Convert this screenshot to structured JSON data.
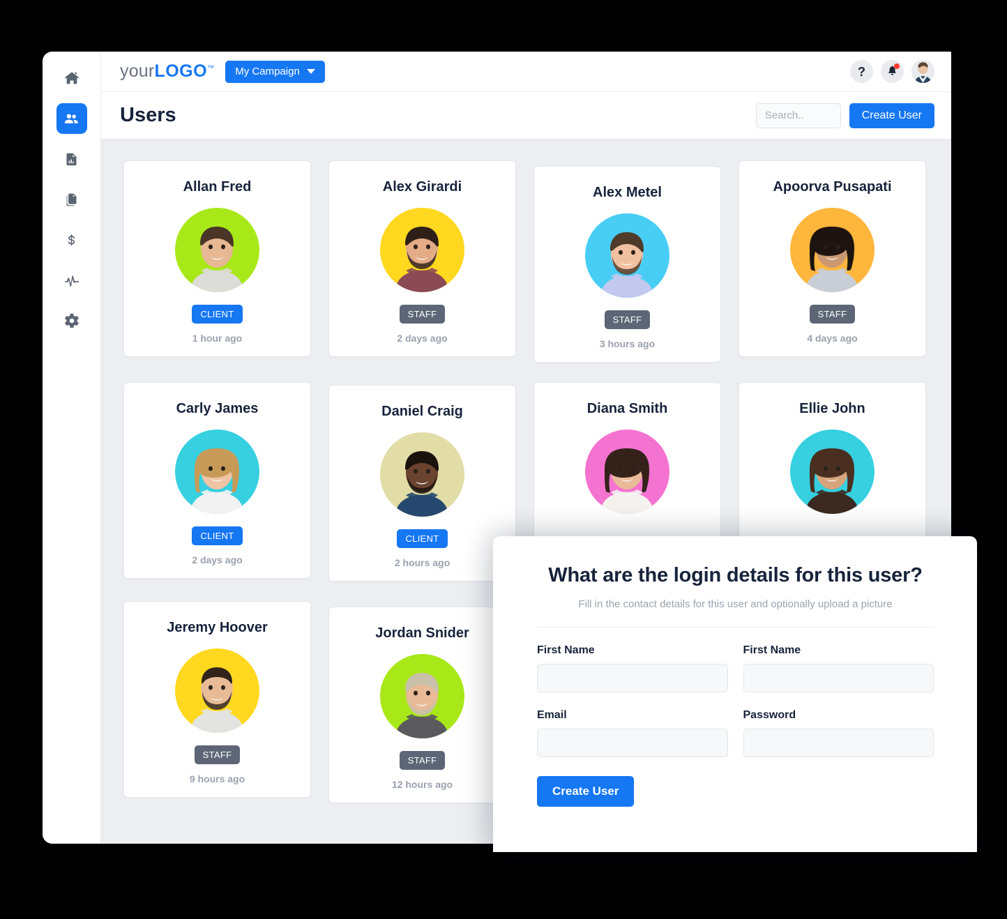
{
  "sidebar": {
    "items": [
      {
        "icon": "home-icon",
        "name": "home",
        "active": false
      },
      {
        "icon": "users-icon",
        "name": "users",
        "active": true
      },
      {
        "icon": "report-icon",
        "name": "reports",
        "active": false
      },
      {
        "icon": "copy-icon",
        "name": "files",
        "active": false
      },
      {
        "icon": "dollar-icon",
        "name": "billing",
        "active": false
      },
      {
        "icon": "activity-icon",
        "name": "activity",
        "active": false
      },
      {
        "icon": "gear-icon",
        "name": "settings",
        "active": false
      }
    ]
  },
  "topbar": {
    "logo_prefix": "your",
    "logo_bold": "LOGO",
    "logo_tm": "™",
    "campaign_label": "My Campaign",
    "help_glyph": "?",
    "icons": [
      "help-icon",
      "notifications-bell-icon",
      "user-avatar"
    ]
  },
  "page_header": {
    "title": "Users",
    "search_placeholder": "Search..",
    "search_value": "",
    "create_user_label": "Create User"
  },
  "users": [
    {
      "name": "Allan Fred",
      "badge": "CLIENT",
      "badge_type": "client",
      "time": "1 hour ago",
      "bg": "#a8e818",
      "photo": "male-smiling",
      "offset": 0
    },
    {
      "name": "Alex Girardi",
      "badge": "STAFF",
      "badge_type": "staff",
      "time": "2 days ago",
      "bg": "#ffd81f",
      "photo": "male-beard",
      "offset": 0
    },
    {
      "name": "Alex Metel",
      "badge": "STAFF",
      "badge_type": "staff",
      "time": "3 hours ago",
      "bg": "#48cdf5",
      "photo": "male-short-hair",
      "offset": 1
    },
    {
      "name": "Apoorva Pusapati",
      "badge": "STAFF",
      "badge_type": "staff",
      "time": "4 days ago",
      "bg": "#ffb63c",
      "photo": "female-long-dark",
      "offset": 0
    },
    {
      "name": "Carly James",
      "badge": "CLIENT",
      "badge_type": "client",
      "time": "2 days ago",
      "bg": "#36d0e0",
      "photo": "female-blonde",
      "offset": 0
    },
    {
      "name": "Daniel Craig",
      "badge": "CLIENT",
      "badge_type": "client",
      "time": "2 hours ago",
      "bg": "#e2dda6",
      "photo": "male-dark-skin",
      "offset": 2
    },
    {
      "name": "Diana Smith",
      "badge": "",
      "badge_type": "",
      "time": "",
      "bg": "#f472d0",
      "photo": "female-brunette",
      "offset": 0
    },
    {
      "name": "Ellie John",
      "badge": "",
      "badge_type": "",
      "time": "",
      "bg": "#36d0e0",
      "photo": "female-long-brown",
      "offset": 0
    },
    {
      "name": "Jeremy Hoover",
      "badge": "STAFF",
      "badge_type": "staff",
      "time": "9 hours ago",
      "bg": "#ffd81f",
      "photo": "male-bald-beard",
      "offset": 0
    },
    {
      "name": "Jordan Snider",
      "badge": "STAFF",
      "badge_type": "staff",
      "time": "12 hours ago",
      "bg": "#a8e818",
      "photo": "male-blond",
      "offset": 1
    }
  ],
  "modal": {
    "title": "What are the login details for this user?",
    "subtitle": "Fill in the contact details for this user and optionally upload a picture",
    "fields": [
      {
        "label": "First Name",
        "value": "",
        "name": "first-name"
      },
      {
        "label": "First Name",
        "value": "",
        "name": "last-name"
      },
      {
        "label": "Email",
        "value": "",
        "name": "email"
      },
      {
        "label": "Password",
        "value": "",
        "name": "password"
      }
    ],
    "submit_label": "Create User"
  },
  "colors": {
    "accent": "#1677f2",
    "staff_badge": "#5c6676",
    "page_bg": "#eceef1",
    "title_text": "#17233b",
    "muted_text": "#9aa1ad",
    "notification_dot": "#ff3b30"
  }
}
